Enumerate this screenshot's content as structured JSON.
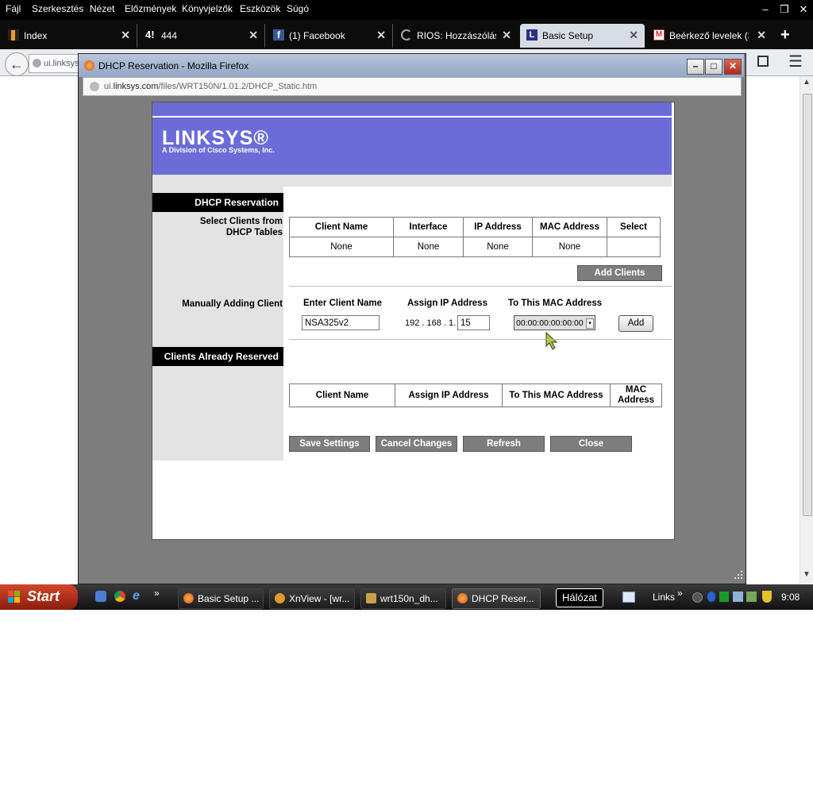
{
  "menubar": {
    "items": [
      "Fájl",
      "Szerkesztés",
      "Nézet",
      "Előzmények",
      "Könyvjelzők",
      "Eszközök",
      "Súgó"
    ]
  },
  "tabs": [
    {
      "label": "Index",
      "icon": "index-icon"
    },
    {
      "label": "444",
      "icon": "444-logo-icon"
    },
    {
      "label": "(1) Facebook",
      "icon": "facebook-icon"
    },
    {
      "label": "RIOS: Hozzászólás ...",
      "icon": "loading-icon"
    },
    {
      "label": "Basic Setup",
      "icon": "linksys-icon",
      "selected": true
    },
    {
      "label": "Beérkező levelek (3...",
      "icon": "gmail-icon"
    }
  ],
  "nav": {
    "url_fragment": "ui.linksys"
  },
  "popup": {
    "title": "DHCP Reservation - Mozilla Firefox",
    "url_prefix": "ui.",
    "url_domain": "linksys.com",
    "url_path": "/files/WRT150N/1.01.2/DHCP_Static.htm"
  },
  "page": {
    "logo": "LINKSYS®",
    "logo_sub": "A Division of Cisco Systems, Inc.",
    "brand_color": "#6c6cd8",
    "section_dhcp": "DHCP Reservation",
    "select_clients_label_1": "Select Clients from",
    "select_clients_label_2": "DHCP Tables",
    "dhcp_table": {
      "headers": [
        "Client Name",
        "Interface",
        "IP Address",
        "MAC Address",
        "Select"
      ],
      "row": [
        "None",
        "None",
        "None",
        "None",
        ""
      ]
    },
    "add_clients": "Add Clients",
    "manual_label": "Manually Adding Client",
    "enter_client_name": "Enter Client Name",
    "assign_ip": "Assign IP Address",
    "to_mac": "To This MAC Address",
    "client_name_value": "NSA325v2",
    "ip_prefix": "192 . 168 . 1.",
    "ip_last_value": "15",
    "mac_value": "00:00:00:00:00:00",
    "add": "Add",
    "section_reserved": "Clients Already Reserved",
    "reserved_table": {
      "headers": [
        "Client Name",
        "Assign IP Address",
        "To This MAC Address",
        "MAC Address"
      ]
    },
    "buttons": {
      "save": "Save Settings",
      "cancel": "Cancel Changes",
      "refresh": "Refresh",
      "close": "Close"
    }
  },
  "taskbar": {
    "start": "Start",
    "buttons": [
      {
        "label": "Basic Setup ...",
        "icon": "firefox-icon"
      },
      {
        "label": "XnView - [wr...",
        "icon": "xnview-icon"
      },
      {
        "label": "wrt150n_dh...",
        "icon": "paint-icon"
      },
      {
        "label": "DHCP Reser...",
        "icon": "firefox-icon",
        "active": true
      }
    ],
    "tooltip": "Hálózat",
    "links": "Links",
    "clock": "9:08"
  }
}
